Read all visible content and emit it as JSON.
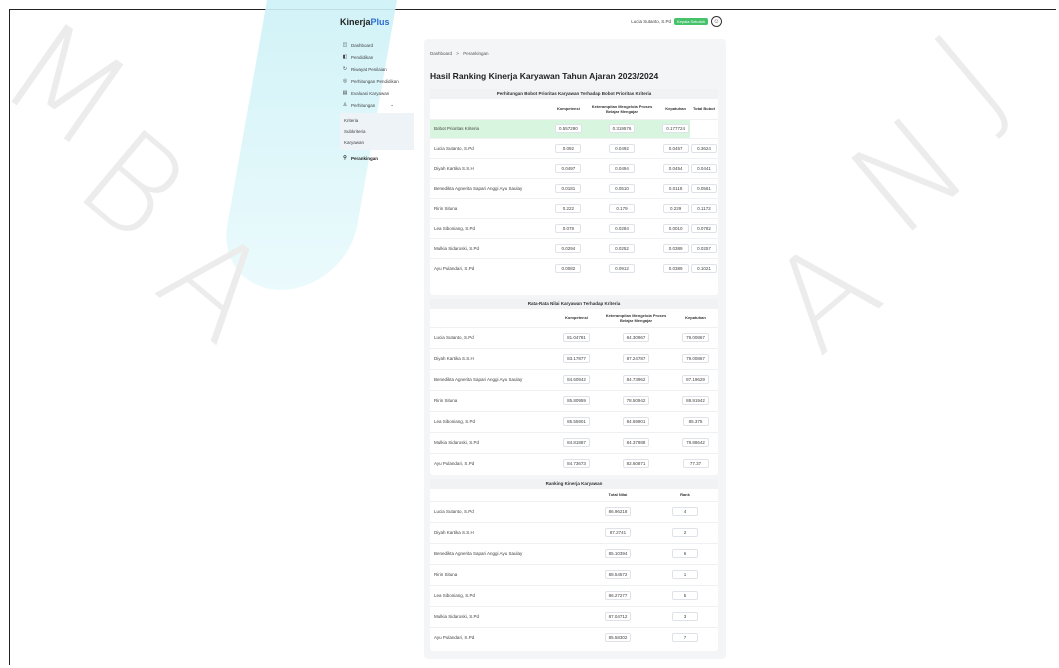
{
  "app": {
    "brand_main": "Kinerja",
    "brand_accent": "Plus",
    "user_name": "Lucia Sutanto, S.Pd",
    "user_badge": "Kepala Sekolah"
  },
  "sidebar": {
    "items": [
      {
        "label": "Dashboard",
        "icon": "dashboard-icon"
      },
      {
        "label": "Pendidikan",
        "icon": "book-icon"
      },
      {
        "label": "Riwayat Penilaian",
        "icon": "history-icon"
      },
      {
        "label": "Perhitungan Pendidikan",
        "icon": "calculator-icon"
      },
      {
        "label": "Evaluasi Karyawan",
        "icon": "document-icon"
      },
      {
        "label": "Perhitungan",
        "icon": "users-icon"
      }
    ],
    "subitems": [
      {
        "label": "Kriteria"
      },
      {
        "label": "Subkriteria"
      },
      {
        "label": "Karyawan"
      }
    ],
    "ranking_item": {
      "label": "Perankingan",
      "icon": "ranking-icon"
    }
  },
  "breadcrumb": {
    "root": "Dashboard",
    "sep": ">",
    "current": "Perankingan"
  },
  "page_title": "Hasil Ranking Kinerja Karyawan Tahun Ajaran 2023/2024",
  "table1": {
    "title": "Perhitungan Bobot Prioritas Karyawan Terhadap Bobot Prioritas Kriteria",
    "headers": [
      "",
      "Kompetensi",
      "Keterampilan Mengelola Proses Belajar Mengajar",
      "Kepatuhan",
      "Total Bobot"
    ],
    "rows": [
      {
        "name": "Bobot Prioritas Kriteria",
        "v": [
          "0.557290",
          "0.319576",
          "0.177724",
          ""
        ]
      },
      {
        "name": "Lucia Sutanto, S.Pd",
        "v": [
          "0.092",
          "0.0492",
          "0.0457",
          "0.3624"
        ]
      },
      {
        "name": "Diyah Kartika S.S.H",
        "v": [
          "0.0497",
          "0.0494",
          "0.0454",
          "0.0441"
        ]
      },
      {
        "name": "Benedikta Agnerita Sapari Anggi Ayu Saulay",
        "v": [
          "0.0181",
          "0.0510",
          "0.0118",
          "0.0561"
        ]
      },
      {
        "name": "Ririn Situna",
        "v": [
          "0.222",
          "0.179",
          "0.229",
          "0.1172"
        ]
      },
      {
        "name": "Lea Siboniang, S.Pd",
        "v": [
          "0.079",
          "0.0284",
          "0.0010",
          "0.0782"
        ]
      },
      {
        "name": "Mulkia Sidaroski, S.Pd",
        "v": [
          "0.0294",
          "0.0252",
          "0.0389",
          "0.0257"
        ]
      },
      {
        "name": "Ayu Pulandari, S.Pd",
        "v": [
          "0.0082",
          "0.0912",
          "0.0389",
          "0.1021"
        ]
      }
    ]
  },
  "table2": {
    "title": "Rata-Rata Nilai Karyawan Terhadap Kriteria",
    "headers": [
      "",
      "Kompetensi",
      "Keterampilan Mengelola Proses Belajar Mengajar",
      "Kepatuhan"
    ],
    "rows": [
      {
        "name": "Lucia Sutanto, S.Pd",
        "v": [
          "81.04781",
          "84.30967",
          "79.00867"
        ]
      },
      {
        "name": "Diyah Kartika S.S.H",
        "v": [
          "83.17877",
          "87.24787",
          "79.00867"
        ]
      },
      {
        "name": "Benedikta Agnerita Sapari Anggi Ayu Saulay",
        "v": [
          "84.60942",
          "84.73962",
          "87.19629"
        ]
      },
      {
        "name": "Ririn Situna",
        "v": [
          "85.80959",
          "78.50942",
          "88.91942"
        ]
      },
      {
        "name": "Lea Siboniang, S.Pd",
        "v": [
          "85.55901",
          "84.69901",
          "85.375"
        ]
      },
      {
        "name": "Mulkia Sidaroski, S.Pd",
        "v": [
          "84.81887",
          "84.37888",
          "79.88642"
        ]
      },
      {
        "name": "Ayu Pulandari, S.Pd",
        "v": [
          "84.73673",
          "82.60871",
          "77.37"
        ]
      }
    ]
  },
  "table3": {
    "title": "Ranking Kinerja Karyawan",
    "headers": [
      "",
      "Total Nilai",
      "Rank"
    ],
    "rows": [
      {
        "name": "Lucia Sutanto, S.Pd",
        "total": "86.96218",
        "rank": "4"
      },
      {
        "name": "Diyah Kartika S.S.H",
        "total": "87.2741",
        "rank": "2"
      },
      {
        "name": "Benedikta Agnerita Sapari Anggi Ayu Saulay",
        "total": "85.10394",
        "rank": "6"
      },
      {
        "name": "Ririn Situna",
        "total": "88.54572",
        "rank": "1"
      },
      {
        "name": "Lea Siboniang, S.Pd",
        "total": "86.27277",
        "rank": "5"
      },
      {
        "name": "Mulkia Sidaroski, S.Pd",
        "total": "87.04712",
        "rank": "3"
      },
      {
        "name": "Ayu Pulandari, S.Pd",
        "total": "85.58302",
        "rank": "7"
      }
    ]
  }
}
